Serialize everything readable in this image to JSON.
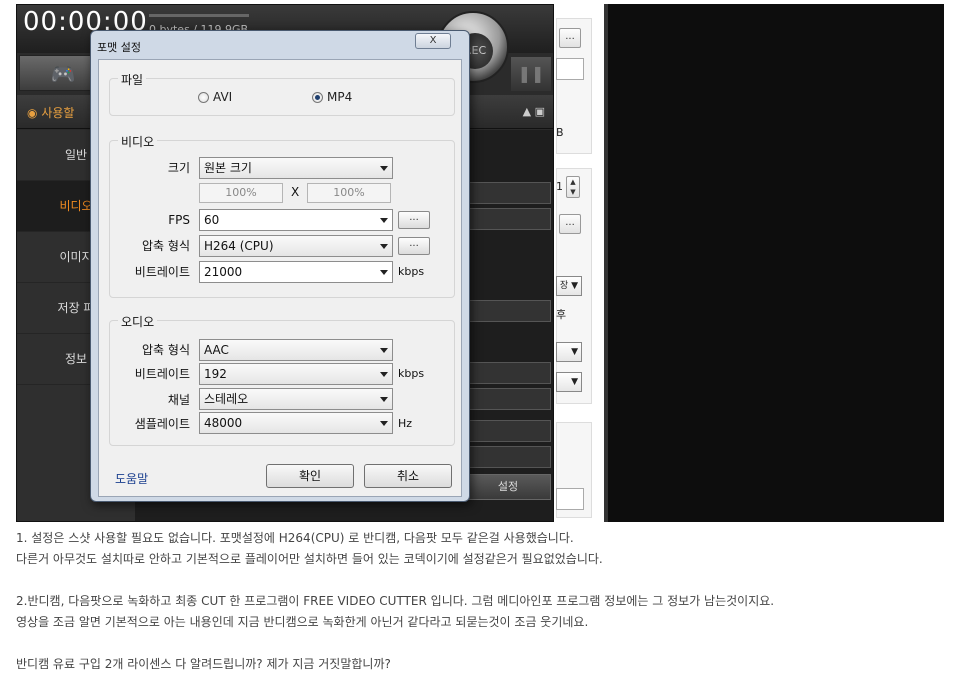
{
  "app": {
    "timer": "00:00:00",
    "size_info": "0 bytes / 119.9GB",
    "rec_label": "REC",
    "game_icon": "gamepad-icon",
    "section_label": "사용할",
    "section_icon": "record-target-icon",
    "side_menu": [
      "일반",
      "비디오",
      "이미지",
      "저장 파",
      "정보"
    ],
    "settings_button": "설정"
  },
  "right_panel": {
    "btn_dots": "...",
    "text_b": "B",
    "spin_value": "1",
    "text_jang": "장",
    "text_hu": "후"
  },
  "dialog": {
    "title": "포맷 설정",
    "close_label": "X",
    "file_group": {
      "label": "파일",
      "options": [
        "AVI",
        "MP4"
      ],
      "selected": "MP4"
    },
    "video_group": {
      "label": "비디오",
      "size_label": "크기",
      "size_value": "원본 크기",
      "width_pct": "100%",
      "x_label": "X",
      "height_pct": "100%",
      "fps_label": "FPS",
      "fps_value": "60",
      "codec_label": "압축 형식",
      "codec_value": "H264 (CPU)",
      "bitrate_label": "비트레이트",
      "bitrate_value": "21000",
      "bitrate_unit": "kbps",
      "dots": "..."
    },
    "audio_group": {
      "label": "오디오",
      "codec_label": "압축 형식",
      "codec_value": "AAC",
      "bitrate_label": "비트레이트",
      "bitrate_value": "192",
      "bitrate_unit": "kbps",
      "channel_label": "채널",
      "channel_value": "스테레오",
      "samplerate_label": "샘플레이트",
      "samplerate_value": "48000",
      "samplerate_unit": "Hz"
    },
    "help_label": "도움말",
    "ok_label": "확인",
    "cancel_label": "취소"
  },
  "article": {
    "lines": [
      "1. 설정은 스샷 사용할 필요도 없습니다. 포맷설정에 H264(CPU) 로 반디캠, 다음팟 모두 같은걸 사용했습니다.",
      "다른거 아무것도 설치따로 안하고 기본적으로 플레이어만 설치하면 들어 있는 코덱이기에 설정같은거 필요없었습니다.",
      "2.반디캠, 다음팟으로 녹화하고 최종 CUT 한 프로그램이 FREE VIDEO CUTTER 입니다. 그럼 메디아인포 프로그램 정보에는 그 정보가 남는것이지요.",
      "영상을 조금 알면 기본적으로 아는 내용인데 지금 반디캠으로 녹화한게 아닌거 같다라고 되묻는것이 조금 웃기네요.",
      "반디캠 유료 구입 2개 라이센스 다 알려드립니까? 제가 지금 거짓말합니까?"
    ]
  }
}
